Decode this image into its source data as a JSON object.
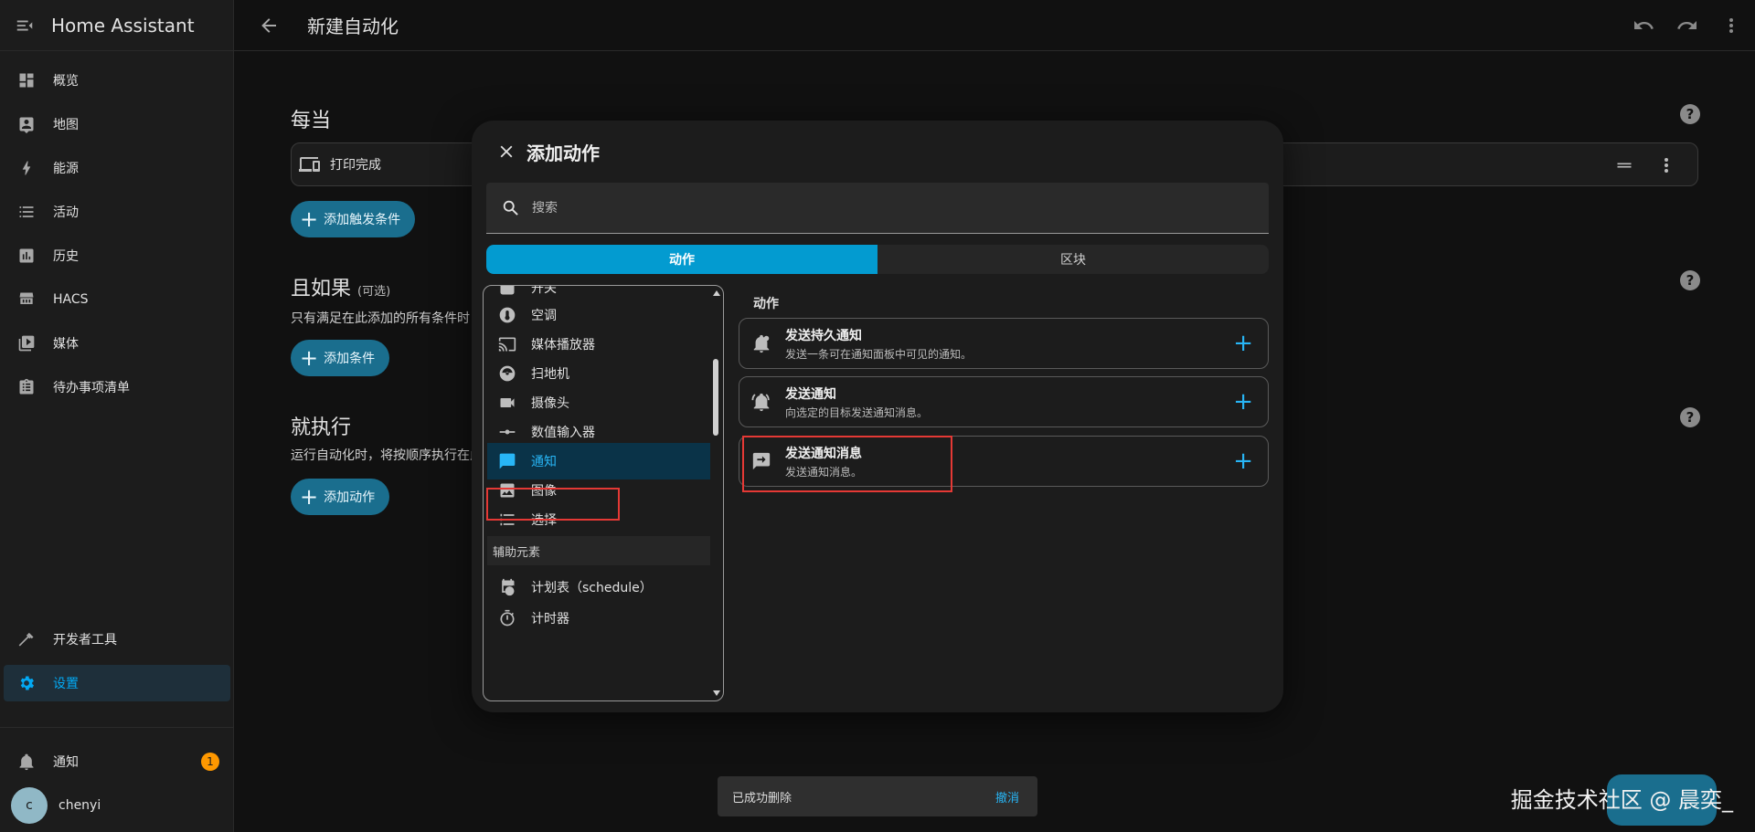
{
  "app": {
    "title": "Home Assistant"
  },
  "page": {
    "title": "新建自动化"
  },
  "sidebar": {
    "items": [
      {
        "label": "概览"
      },
      {
        "label": "地图"
      },
      {
        "label": "能源"
      },
      {
        "label": "活动"
      },
      {
        "label": "历史"
      },
      {
        "label": "HACS"
      },
      {
        "label": "媒体"
      },
      {
        "label": "待办事项清单"
      }
    ],
    "bottom": [
      {
        "label": "开发者工具"
      },
      {
        "label": "设置"
      }
    ],
    "notifications": {
      "label": "通知",
      "count": "1"
    },
    "user": {
      "name": "chenyi",
      "initial": "c"
    }
  },
  "editor": {
    "when": {
      "title": "每当",
      "trigger_label": "打印完成",
      "add_button": "添加触发条件"
    },
    "and_if": {
      "title": "且如果",
      "optional": "(可选)",
      "desc": "只有满足在此添加的所有条件时",
      "add_button": "添加条件"
    },
    "then": {
      "title": "就执行",
      "desc": "运行自动化时，将按顺序执行在此",
      "add_button": "添加动作"
    }
  },
  "dialog": {
    "title": "添加动作",
    "search_placeholder": "搜索",
    "tabs": [
      {
        "label": "动作"
      },
      {
        "label": "区块"
      }
    ],
    "categories": [
      {
        "label": "开关"
      },
      {
        "label": "空调"
      },
      {
        "label": "媒体播放器"
      },
      {
        "label": "扫地机"
      },
      {
        "label": "摄像头"
      },
      {
        "label": "数值输入器"
      },
      {
        "label": "通知"
      },
      {
        "label": "图像"
      },
      {
        "label": "选择"
      }
    ],
    "helpers_header": "辅助元素",
    "helpers": [
      {
        "label": "计划表（schedule）"
      },
      {
        "label": "计时器"
      }
    ],
    "actions_title": "动作",
    "actions": [
      {
        "title": "发送持久通知",
        "desc": "发送一条可在通知面板中可见的通知。"
      },
      {
        "title": "发送通知",
        "desc": "向选定的目标发送通知消息。"
      },
      {
        "title": "发送通知消息",
        "desc": "发送通知消息。"
      }
    ]
  },
  "snackbar": {
    "message": "已成功删除",
    "action": "撤消"
  },
  "watermark": "掘金技术社区 @ 晨奕_"
}
